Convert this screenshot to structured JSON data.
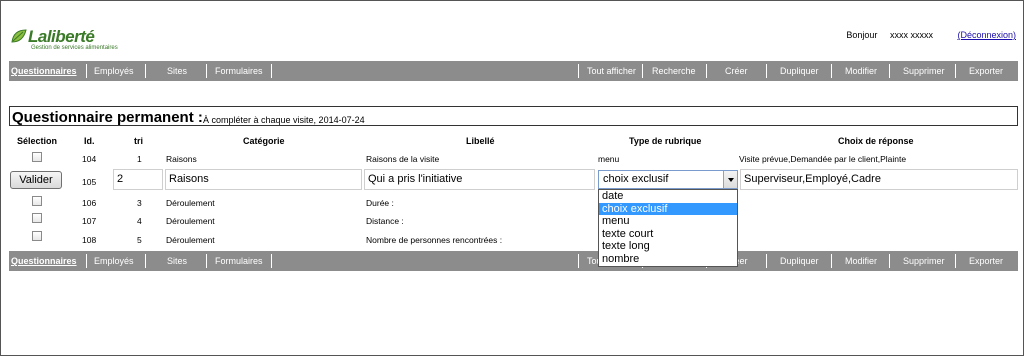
{
  "brand": {
    "name": "Laliberté",
    "tagline": "Gestion de services alimentaires"
  },
  "user": {
    "greeting": "Bonjour",
    "name": "xxxx xxxxx",
    "logout": "(Déconnexion)"
  },
  "nav_left": [
    "Questionnaires",
    "Employés",
    "Sites",
    "Formulaires"
  ],
  "nav_right": [
    "Tout afficher",
    "Recherche",
    "Créer",
    "Dupliquer",
    "Modifier",
    "Supprimer",
    "Exporter"
  ],
  "panel": {
    "title": "Questionnaire permanent :",
    "subtitle": "À compléter à chaque visite, 2014-07-24"
  },
  "columns": {
    "selection": "Sélection",
    "id": "Id.",
    "tri": "tri",
    "category": "Catégorie",
    "label": "Libellé",
    "type": "Type de rubrique",
    "choices": "Choix de réponse"
  },
  "rows": [
    {
      "id": "104",
      "tri": "1",
      "category": "Raisons",
      "label": "Raisons de la visite",
      "type": "menu",
      "choices": "Visite prévue,Demandée par le client,Plainte"
    },
    {
      "id": "106",
      "tri": "3",
      "category": "Déroulement",
      "label": "Durée :",
      "type": "",
      "choices": ""
    },
    {
      "id": "107",
      "tri": "4",
      "category": "Déroulement",
      "label": "Distance :",
      "type": "",
      "choices": ""
    },
    {
      "id": "108",
      "tri": "5",
      "category": "Déroulement",
      "label": "Nombre de personnes rencontrées :",
      "type": "",
      "choices": ""
    }
  ],
  "edit_row": {
    "button": "Valider",
    "id": "105",
    "tri": "2",
    "category": "Raisons",
    "label": "Qui a pris l'initiative",
    "type": "choix exclusif",
    "choices": "Superviseur,Employé,Cadre"
  },
  "type_options": [
    "date",
    "choix exclusif",
    "menu",
    "texte court",
    "texte long",
    "nombre"
  ],
  "type_option_selected": "choix exclusif",
  "colors": {
    "nav_bg": "#8c8c8c",
    "brand_green": "#3a7a28",
    "highlight": "#3399ff"
  }
}
